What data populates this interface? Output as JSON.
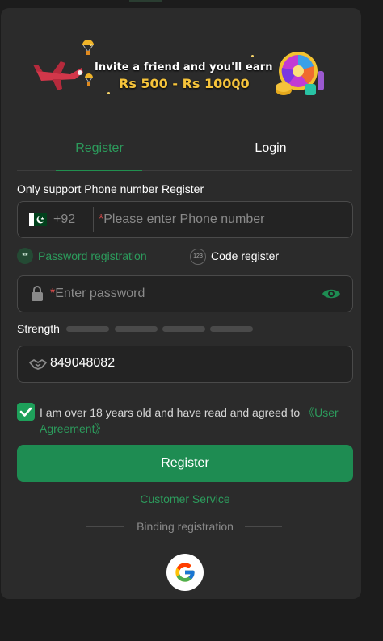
{
  "banner": {
    "line1": "Invite a friend and you'll earn",
    "line2": "Rs 500 - Rs 10000"
  },
  "tabs": [
    {
      "label": "Register",
      "active": true
    },
    {
      "label": "Login",
      "active": false
    }
  ],
  "form": {
    "support_label": "Only support Phone number Register",
    "country_code": "+92",
    "phone_required_mark": "*",
    "phone_placeholder": "Please enter Phone number",
    "mode_password_icon": "**",
    "mode_password_label": "Password registration",
    "mode_code_icon": "123",
    "mode_code_label": "Code register",
    "password_required_mark": "*",
    "password_placeholder": "Enter password",
    "strength_label": "Strength",
    "invite_code_value": "849048082",
    "agreement_text": "I am over 18 years old and have read and agreed to ",
    "agreement_link": "《User Agreement》",
    "submit_label": "Register"
  },
  "footer": {
    "customer_service": "Customer Service",
    "binding_label": "Binding registration"
  },
  "colors": {
    "accent": "#1e8c52",
    "background": "#2b2b2b",
    "field_border": "#4a4a4a"
  },
  "icons": [
    "pakistan-flag-icon",
    "lock-icon",
    "eye-icon",
    "handshake-icon",
    "check-icon",
    "google-icon"
  ]
}
